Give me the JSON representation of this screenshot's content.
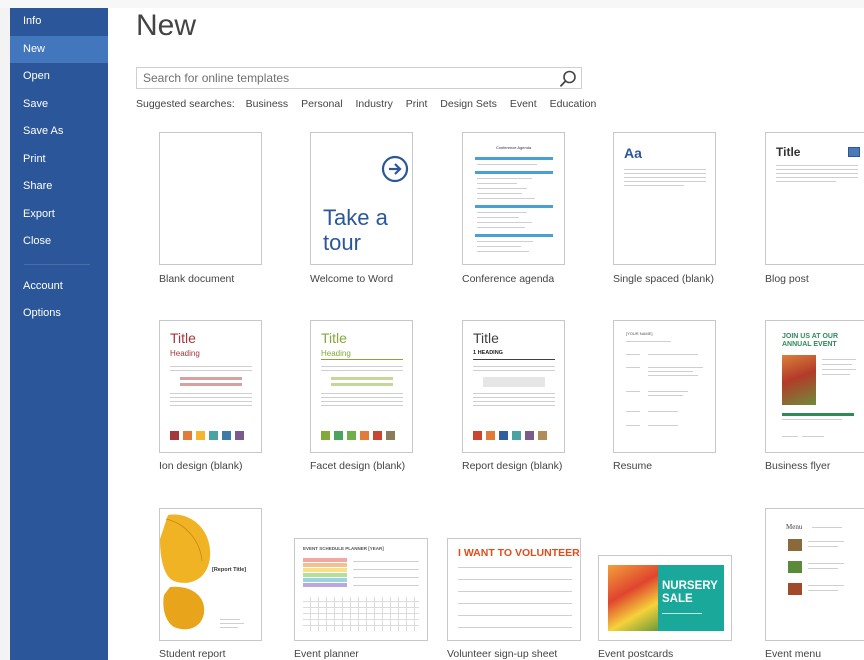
{
  "sidebar": {
    "items": [
      "Info",
      "New",
      "Open",
      "Save",
      "Save As",
      "Print",
      "Share",
      "Export",
      "Close"
    ],
    "bottom_items": [
      "Account",
      "Options"
    ],
    "selected": "New"
  },
  "main": {
    "title": "New",
    "search": {
      "placeholder": "Search for online templates"
    },
    "suggested_label": "Suggested searches:",
    "suggested": [
      "Business",
      "Personal",
      "Industry",
      "Print",
      "Design Sets",
      "Event",
      "Education"
    ]
  },
  "thumb_text": {
    "take_a_tour": [
      "Take a",
      "tour"
    ],
    "conference_heading": "Conference Agenda",
    "single_spaced": "Aa",
    "blog_title": "Title",
    "ion_title": "Title",
    "ion_heading": "Heading",
    "facet_title": "Title",
    "facet_heading": "Heading",
    "report_title": "Title",
    "report_heading": "1   HEADING",
    "resume_name": "[YOUR NAME]",
    "flyer_heading": "JOIN US AT OUR ANNUAL EVENT",
    "student_report_title": "[Report Title]",
    "planner_heading": "EVENT SCHEDULE PLANNER [YEAR]",
    "volunteer_heading": "I WANT TO VOLUNTEER",
    "postcard_heading": [
      "NURSERY",
      "SALE"
    ],
    "menu_heading": "Menu"
  },
  "templates": [
    {
      "label": "Blank document"
    },
    {
      "label": "Welcome to Word"
    },
    {
      "label": "Conference agenda"
    },
    {
      "label": "Single spaced (blank)"
    },
    {
      "label": "Blog post"
    },
    {
      "label": "Ion design (blank)"
    },
    {
      "label": "Facet design (blank)"
    },
    {
      "label": "Report design (blank)"
    },
    {
      "label": "Resume"
    },
    {
      "label": "Business flyer"
    },
    {
      "label": "Student report"
    },
    {
      "label": "Event planner"
    },
    {
      "label": "Volunteer sign-up sheet"
    },
    {
      "label": "Event postcards"
    },
    {
      "label": "Event menu"
    }
  ],
  "colors": {
    "sidebar": "#2b579a",
    "sidebar_selected": "#4276bd",
    "ion_accent": "#a4373a",
    "facet_accent": "#84a83a",
    "report_accent": "#404040",
    "volunteer_accent": "#e64a19",
    "postcard_accent": "#1aa89a",
    "flyer_accent": "#2e8b57"
  }
}
